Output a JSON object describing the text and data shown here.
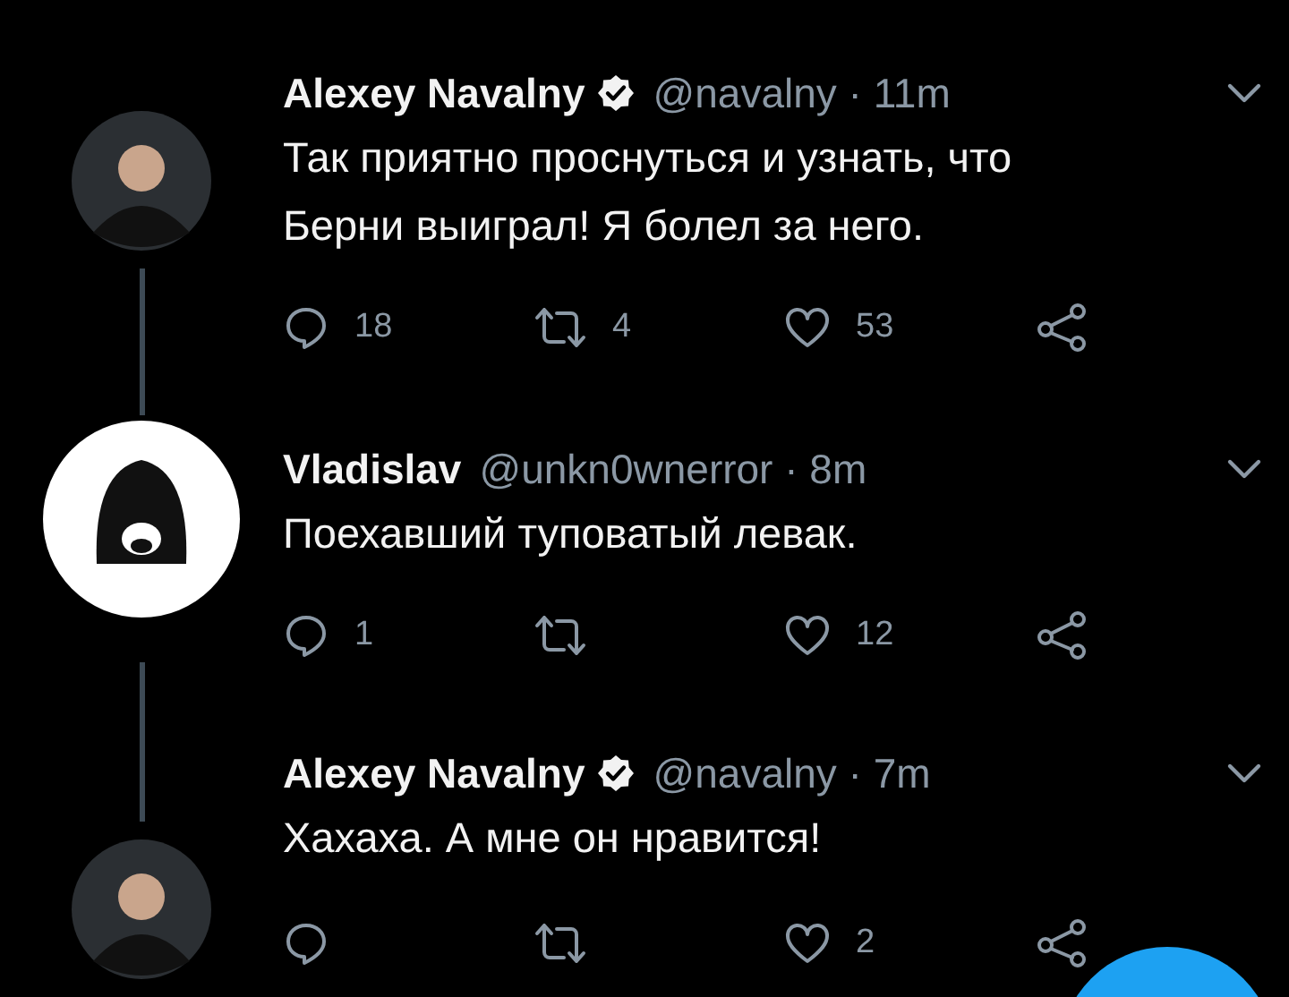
{
  "tweets": [
    {
      "avatar": {
        "kind": "person"
      },
      "name": "Alexey Navalny",
      "verified": true,
      "meta": "@navalny · 11m",
      "lines": [
        "Так приятно проснуться и узнать, что",
        "Берни выиграл! Я болел за него."
      ],
      "replies": "18",
      "retweets": "4",
      "likes": "53",
      "thread_above": false,
      "thread_below": true
    },
    {
      "avatar": {
        "kind": "hood"
      },
      "name": "Vladislav",
      "verified": false,
      "meta": "@unkn0wnerror · 8m",
      "lines": [
        "Поехавший туповатый левак."
      ],
      "replies": "1",
      "likes": "12",
      "thread_above": true,
      "thread_below": true
    },
    {
      "avatar": {
        "kind": "person"
      },
      "name": "Alexey Navalny",
      "verified": true,
      "meta": "@navalny · 7m",
      "lines": [
        "Хахаха. А мне он нравится!"
      ],
      "likes": "2",
      "thread_above": true,
      "thread_below": false
    }
  ]
}
